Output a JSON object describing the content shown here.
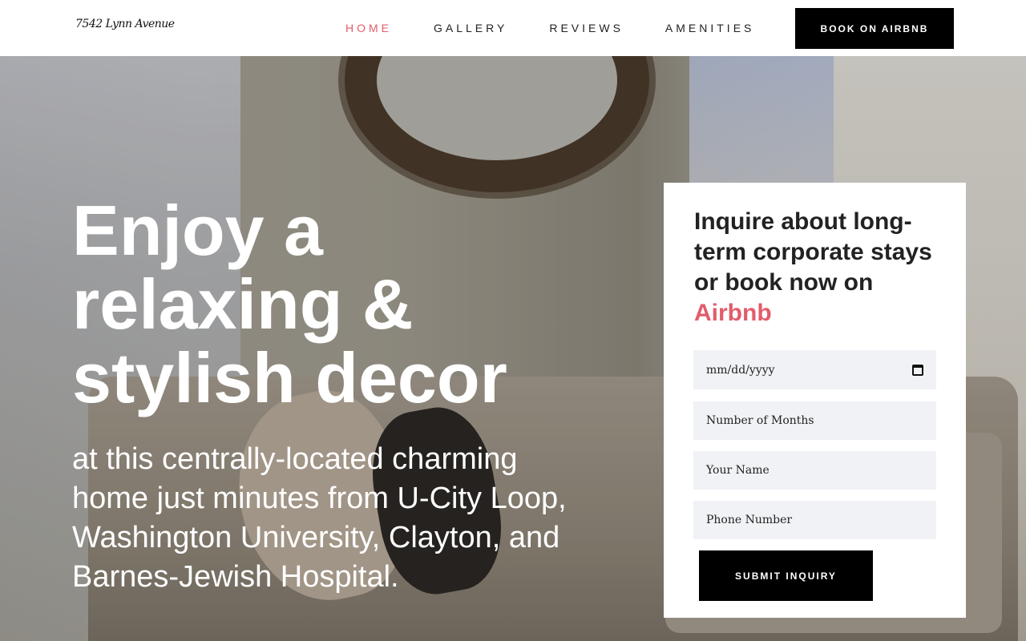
{
  "header": {
    "logo": "7542 Lynn Avenue",
    "nav": [
      {
        "label": "HOME",
        "active": true
      },
      {
        "label": "GALLERY",
        "active": false
      },
      {
        "label": "REVIEWS",
        "active": false
      },
      {
        "label": "AMENITIES",
        "active": false
      }
    ],
    "book_button": "BOOK ON AIRBNB"
  },
  "hero": {
    "headline": "Enjoy a relaxing & stylish decor",
    "subline": "at this centrally-located charming home just minutes from U-City Loop, Washington University, Clayton, and Barnes-Jewish Hospital."
  },
  "inquiry": {
    "title_main": "Inquire about long-term corporate stays or book now on",
    "title_accent": "Airbnb",
    "date_placeholder": "mm/dd/yyyy",
    "months_placeholder": "Number of Months",
    "name_placeholder": "Your Name",
    "phone_placeholder": "Phone Number",
    "submit_label": "SUBMIT INQUIRY"
  },
  "colors": {
    "accent": "#e25c6b",
    "button": "#000000",
    "field_bg": "#f1f2f6"
  }
}
